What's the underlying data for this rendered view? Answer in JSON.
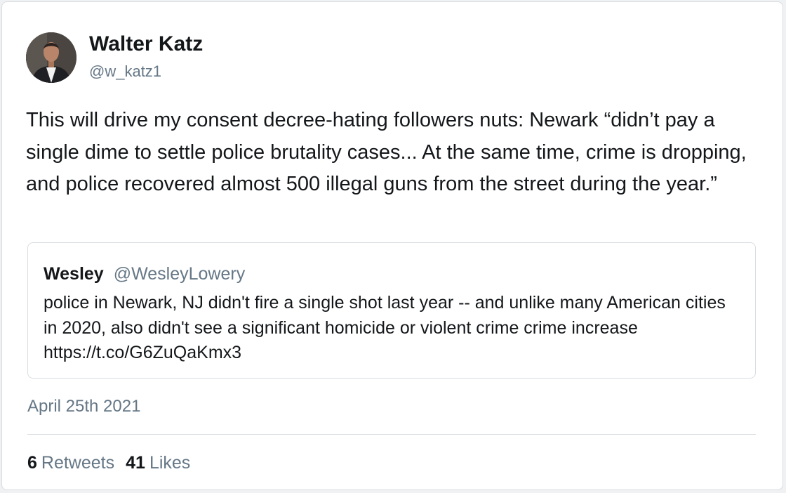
{
  "tweet": {
    "author": {
      "name": "Walter Katz",
      "handle": "@w_katz1"
    },
    "text": "This will drive my consent decree-hating followers nuts: Newark “didn’t pay a single dime to settle police brutality cases... At the same time, crime is dropping, and police recovered almost 500 illegal guns from the street during the year.”",
    "quoted": {
      "name": "Wesley",
      "handle": "@WesleyLowery",
      "text": "police in Newark, NJ didn't fire a single shot last year -- and unlike many American cities in 2020, also didn't see a significant homicide or violent crime crime increase https://t.co/G6ZuQaKmx3"
    },
    "date": "April 25th 2021",
    "stats": {
      "retweets_count": "6",
      "retweets_label": "Retweets",
      "likes_count": "41",
      "likes_label": "Likes"
    }
  }
}
